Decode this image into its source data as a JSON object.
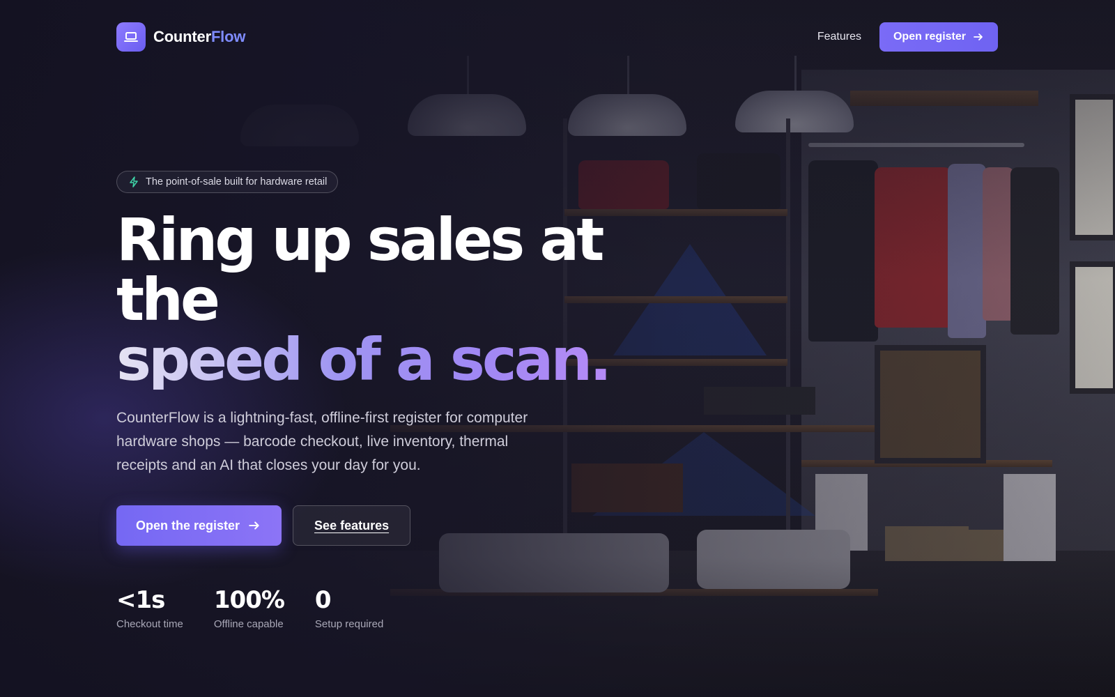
{
  "brand": {
    "name_part1": "Counter",
    "name_part2": "Flow",
    "icon": "laptop-icon",
    "accent": "#7f8cff"
  },
  "nav": {
    "features_label": "Features",
    "cta_label": "Open register",
    "cta_icon": "arrow-right-icon"
  },
  "hero": {
    "pill_icon": "lightning-icon",
    "pill_text": "The point-of-sale built for hardware retail",
    "headline_line1": "Ring up sales at the",
    "headline_line2": "speed of a scan.",
    "lead": "CounterFlow is a lightning-fast, offline-first register for computer hardware shops — barcode checkout, live inventory, thermal receipts and an AI that closes your day for you.",
    "primary_cta": "Open the register",
    "primary_cta_icon": "arrow-right-icon",
    "secondary_cta": "See features"
  },
  "stats": [
    {
      "value": "<1s",
      "label": "Checkout time"
    },
    {
      "value": "100%",
      "label": "Offline capable"
    },
    {
      "value": "0",
      "label": "Setup required"
    }
  ],
  "colors": {
    "primary": "#7568f3",
    "pill_icon": "#3ed3a7",
    "background": "#14121f"
  }
}
